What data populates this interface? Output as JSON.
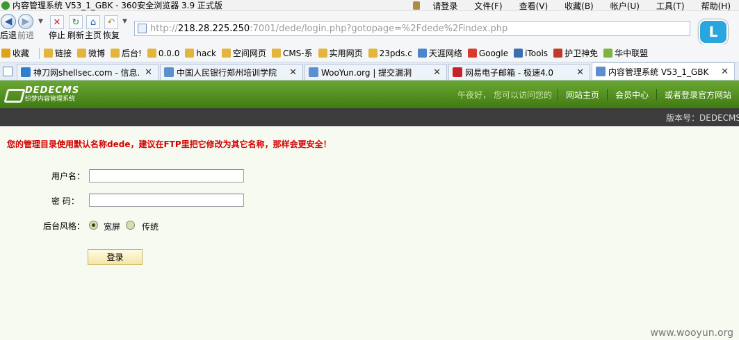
{
  "window": {
    "title": "内容管理系统 V53_1_GBK - 360安全浏览器 3.9 正式版",
    "menu": [
      "请登录",
      "文件(F)",
      "查看(V)",
      "收藏(B)",
      "帐户(U)",
      "工具(T)",
      "帮助(H)"
    ]
  },
  "toolbar": {
    "back_label": "后退",
    "forward_label": "前进",
    "stop_label": "停止",
    "refresh_label": "刷新",
    "home_label": "主页",
    "restore_label": "恢复",
    "url_prefix": "http://",
    "url_host": "218.28.225.250",
    "url_rest": ":7001/dede/login.php?gotopage=%2Fdede%2Findex.php",
    "badge_letter": "L"
  },
  "favorites": [
    {
      "label": "收藏",
      "color": "#e0a21a"
    },
    {
      "label": "链接",
      "color": "#e3b53c"
    },
    {
      "label": "微博",
      "color": "#e3b53c"
    },
    {
      "label": "后台!",
      "color": "#e3b53c"
    },
    {
      "label": "0.0.0",
      "color": "#e3b53c"
    },
    {
      "label": "hack",
      "color": "#e3b53c"
    },
    {
      "label": "空间网页",
      "color": "#e3b53c"
    },
    {
      "label": "CMS-系",
      "color": "#e3b53c"
    },
    {
      "label": "实用网页",
      "color": "#e3b53c"
    },
    {
      "label": "23pds.c",
      "color": "#e3b53c"
    },
    {
      "label": "天涯网络",
      "color": "#4b86c8"
    },
    {
      "label": "Google",
      "color": "#d83b2d"
    },
    {
      "label": "iTools",
      "color": "#3a6fb0"
    },
    {
      "label": "护卫神免",
      "color": "#c0392b"
    },
    {
      "label": "华中联盟",
      "color": "#7cb342"
    }
  ],
  "tabs": [
    {
      "label": "神刀网shellsec.com - 信息...",
      "icon_color": "#2f7fd0",
      "active": false
    },
    {
      "label": "中国人民银行郑州培训学院",
      "icon_color": "#5b8fd0",
      "active": false
    },
    {
      "label": "WooYun.org | 提交漏洞",
      "icon_color": "#5b8fd0",
      "active": false
    },
    {
      "label": "网易电子邮箱 - 极速4.0",
      "icon_color": "#c8202a",
      "active": false
    },
    {
      "label": "内容管理系统 V53_1_GBK",
      "icon_color": "#5b8fd0",
      "active": true
    }
  ],
  "cms": {
    "logo_main": "DEDECMS",
    "logo_sub": "织梦内容管理系统",
    "greeting": "午夜好，  您可以访问您的",
    "nav": [
      "网站主页",
      "会员中心",
      "或者登录官方网站"
    ],
    "version": "版本号：DEDECMS"
  },
  "login": {
    "warning": "您的管理目录使用默认名称dede，建议在FTP里把它修改为其它名称，那样会更安全！",
    "username_label": "用户名：",
    "password_label": "密   码：",
    "style_label": "后台风格：",
    "style_options": [
      "宽屏",
      "传统"
    ],
    "style_selected": "宽屏",
    "username_value": "",
    "password_value": "",
    "submit_label": "登录"
  },
  "watermark": "www.wooyun.org"
}
